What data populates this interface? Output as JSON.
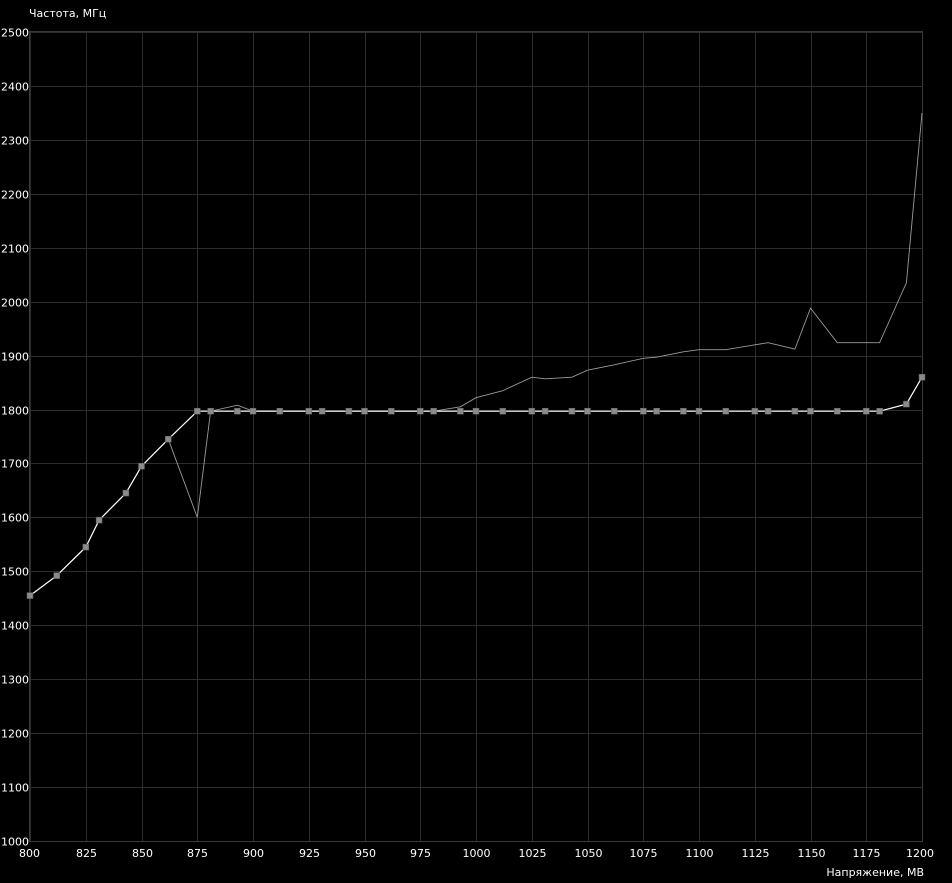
{
  "chart_data": {
    "type": "line",
    "ylabel": "Частота, МГц",
    "xlabel": "Напряжение, МВ",
    "xlim": [
      800,
      1200
    ],
    "ylim": [
      1000,
      2500
    ],
    "x_ticks": [
      "800",
      "825",
      "850",
      "875",
      "900",
      "925",
      "950",
      "975",
      "1000",
      "1025",
      "1050",
      "1075",
      "1100",
      "1125",
      "1150",
      "1175",
      "1200"
    ],
    "y_ticks": [
      "1000",
      "1100",
      "1200",
      "1300",
      "1400",
      "1500",
      "1600",
      "1700",
      "1800",
      "1900",
      "2000",
      "2100",
      "2200",
      "2300",
      "2400",
      "2500"
    ],
    "grid": true,
    "series": [
      {
        "style": "thin-gray",
        "color": "#9a9a9a",
        "points": [
          [
            800,
            1455
          ],
          [
            812,
            1492
          ],
          [
            825,
            1545
          ],
          [
            831,
            1595
          ],
          [
            843,
            1645
          ],
          [
            850,
            1695
          ],
          [
            862,
            1745
          ],
          [
            875,
            1600
          ],
          [
            881,
            1797
          ],
          [
            893,
            1808
          ],
          [
            900,
            1797
          ],
          [
            912,
            1797
          ],
          [
            925,
            1797
          ],
          [
            931,
            1797
          ],
          [
            943,
            1797
          ],
          [
            950,
            1797
          ],
          [
            962,
            1797
          ],
          [
            975,
            1797
          ],
          [
            981,
            1797
          ],
          [
            993,
            1805
          ],
          [
            1000,
            1822
          ],
          [
            1012,
            1835
          ],
          [
            1025,
            1860
          ],
          [
            1031,
            1857
          ],
          [
            1043,
            1860
          ],
          [
            1050,
            1873
          ],
          [
            1062,
            1883
          ],
          [
            1075,
            1895
          ],
          [
            1081,
            1897
          ],
          [
            1093,
            1907
          ],
          [
            1100,
            1911
          ],
          [
            1112,
            1911
          ],
          [
            1125,
            1920
          ],
          [
            1131,
            1924
          ],
          [
            1143,
            1912
          ],
          [
            1150,
            1988
          ],
          [
            1162,
            1924
          ],
          [
            1175,
            1924
          ],
          [
            1181,
            1924
          ],
          [
            1193,
            2035
          ],
          [
            1200,
            2350
          ]
        ]
      },
      {
        "style": "white-with-markers",
        "color": "#ffffff",
        "marker_color": "#8a8a8a",
        "points": [
          [
            800,
            1455
          ],
          [
            812,
            1492
          ],
          [
            825,
            1545
          ],
          [
            831,
            1595
          ],
          [
            843,
            1645
          ],
          [
            850,
            1695
          ],
          [
            862,
            1745
          ],
          [
            875,
            1797
          ],
          [
            881,
            1797
          ],
          [
            893,
            1797
          ],
          [
            900,
            1797
          ],
          [
            912,
            1797
          ],
          [
            925,
            1797
          ],
          [
            931,
            1797
          ],
          [
            943,
            1797
          ],
          [
            950,
            1797
          ],
          [
            962,
            1797
          ],
          [
            975,
            1797
          ],
          [
            981,
            1797
          ],
          [
            993,
            1797
          ],
          [
            1000,
            1797
          ],
          [
            1012,
            1797
          ],
          [
            1025,
            1797
          ],
          [
            1031,
            1797
          ],
          [
            1043,
            1797
          ],
          [
            1050,
            1797
          ],
          [
            1062,
            1797
          ],
          [
            1075,
            1797
          ],
          [
            1081,
            1797
          ],
          [
            1093,
            1797
          ],
          [
            1100,
            1797
          ],
          [
            1112,
            1797
          ],
          [
            1125,
            1797
          ],
          [
            1131,
            1797
          ],
          [
            1143,
            1797
          ],
          [
            1150,
            1797
          ],
          [
            1162,
            1797
          ],
          [
            1175,
            1797
          ],
          [
            1181,
            1797
          ],
          [
            1193,
            1810
          ],
          [
            1200,
            1860
          ]
        ]
      }
    ]
  }
}
